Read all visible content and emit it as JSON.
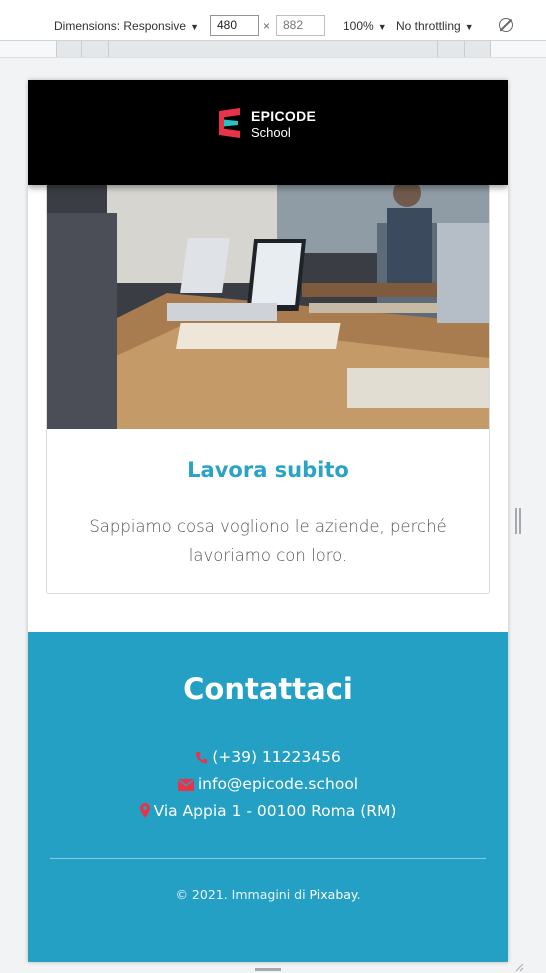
{
  "devtools": {
    "dimensions_label": "Dimensions: Responsive",
    "width_value": "480",
    "times_sign": "×",
    "height_value": "882",
    "zoom_label": "100%",
    "throttle_label": "No throttling",
    "caret": "▼"
  },
  "header": {
    "brand": "EPICODE",
    "brand_sub": "School",
    "logo_colors": [
      "#e8344a",
      "#2bbfc6"
    ]
  },
  "card": {
    "image_icon": "team-meeting-photo",
    "title": "Lavora subito",
    "text": "Sappiamo cosa vogliono le aziende, perché lavoriamo con loro."
  },
  "footer": {
    "title": "Contattaci",
    "phone_icon": "phone-icon",
    "phone": "(+39) 11223456",
    "email_icon": "envelope-icon",
    "email": "info@epicode.school",
    "address_icon": "map-marker-icon",
    "address": "Via Appia 1 - 00100 Roma (RM)",
    "copyright_prefix": "© 2021. Immagini di ",
    "copyright_link": "Pixabay",
    "copyright_suffix": ".",
    "accent_color": "#24a0c4",
    "icon_color": "#e8344a"
  }
}
